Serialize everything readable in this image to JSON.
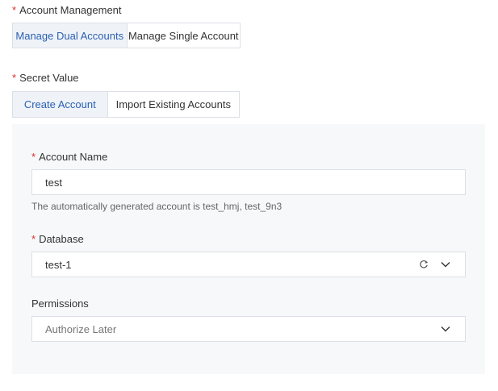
{
  "account_management": {
    "required_mark": "*",
    "label": "Account Management",
    "options": [
      {
        "label": "Manage Dual Accounts",
        "active": true
      },
      {
        "label": "Manage Single Account",
        "active": false
      }
    ]
  },
  "secret_value": {
    "required_mark": "*",
    "label": "Secret Value",
    "options": [
      {
        "label": "Create Account",
        "active": true
      },
      {
        "label": "Import Existing Accounts",
        "active": false
      }
    ]
  },
  "create_account_panel": {
    "account_name": {
      "required_mark": "*",
      "label": "Account Name",
      "value": "test",
      "help": "The automatically generated account is test_hmj, test_9n3"
    },
    "database": {
      "required_mark": "*",
      "label": "Database",
      "value": "test-1",
      "icons": [
        "refresh-icon",
        "chevron-down-icon"
      ]
    },
    "permissions": {
      "label": "Permissions",
      "placeholder": "Authorize Later",
      "icons": [
        "chevron-down-icon"
      ]
    }
  },
  "colors": {
    "required": "#d93026",
    "active_text": "#2b5fb3",
    "active_bg": "#eff3f8",
    "border": "#dcdfe6",
    "panel_bg": "#f7f8fa"
  }
}
